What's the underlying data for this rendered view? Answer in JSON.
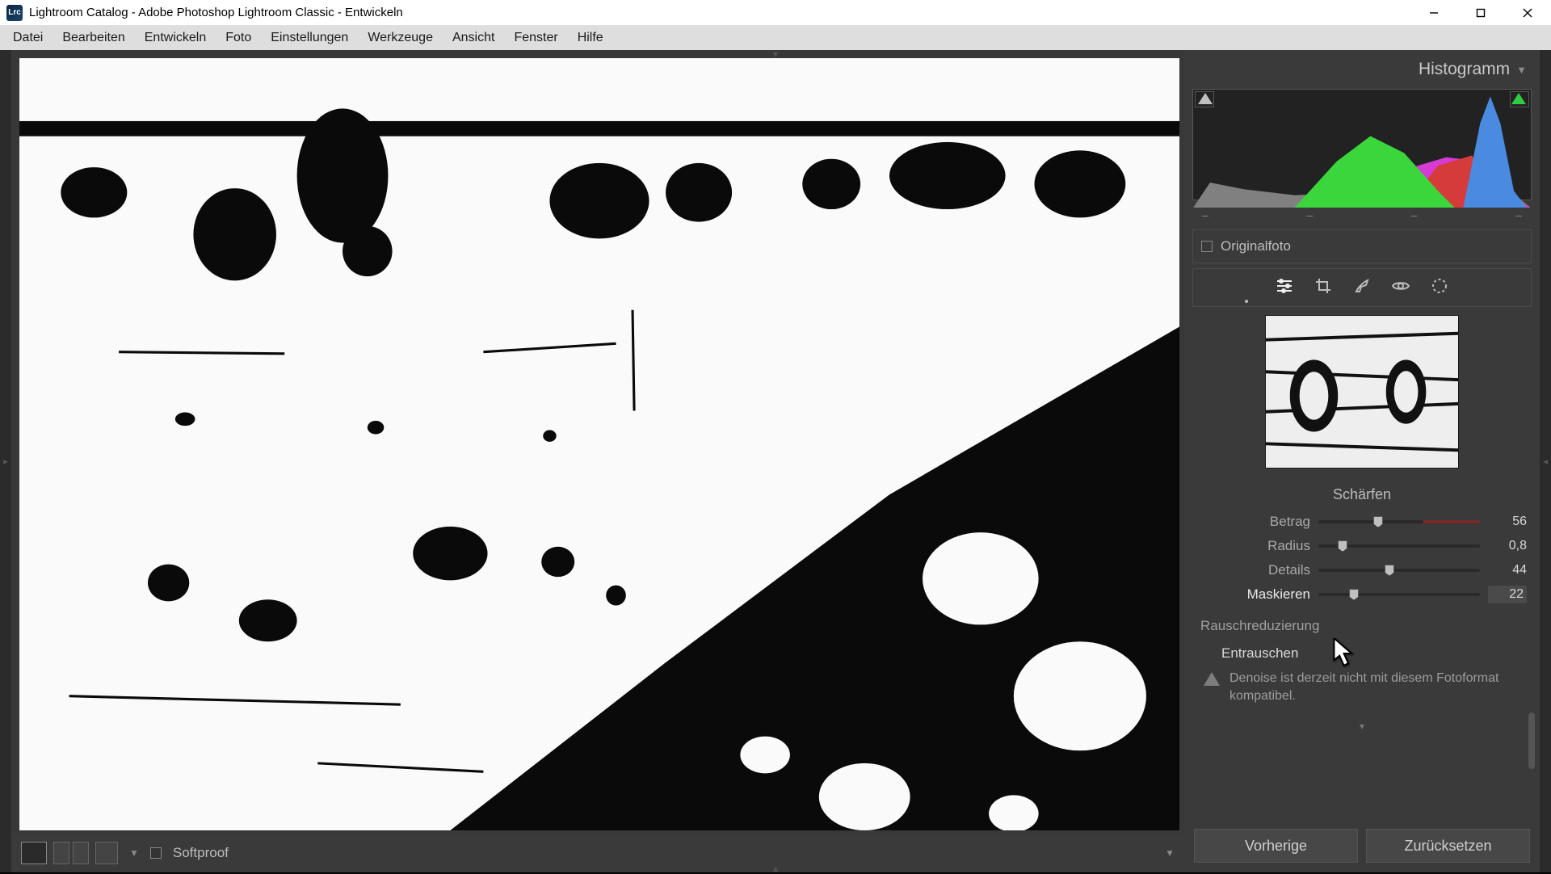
{
  "window": {
    "title": "Lightroom Catalog - Adobe Photoshop Lightroom Classic - Entwickeln",
    "icon_text": "Lrc"
  },
  "menu": {
    "items": [
      "Datei",
      "Bearbeiten",
      "Entwickeln",
      "Foto",
      "Einstellungen",
      "Werkzeuge",
      "Ansicht",
      "Fenster",
      "Hilfe"
    ]
  },
  "histogram": {
    "title": "Histogramm",
    "readouts": [
      "–",
      "–",
      "–",
      "–"
    ]
  },
  "original_row": {
    "label": "Originalfoto"
  },
  "toolstrip": {
    "icons": [
      "sliders-icon",
      "crop-icon",
      "brush-icon",
      "redeye-icon",
      "radial-icon"
    ]
  },
  "sharpen": {
    "title": "Schärfen",
    "amount": {
      "label": "Betrag",
      "value": "56",
      "pos": 37
    },
    "radius": {
      "label": "Radius",
      "value": "0,8",
      "pos": 15
    },
    "details": {
      "label": "Details",
      "value": "44",
      "pos": 44
    },
    "masking": {
      "label": "Maskieren",
      "value": "22",
      "pos": 22
    }
  },
  "noise": {
    "header": "Rauschreduzierung",
    "denoise_label": "Entrauschen",
    "warning": "Denoise ist derzeit nicht mit diesem Fotoformat kompatibel."
  },
  "footer": {
    "previous": "Vorherige",
    "reset": "Zurücksetzen"
  },
  "bottombar": {
    "softproof": "Softproof"
  }
}
